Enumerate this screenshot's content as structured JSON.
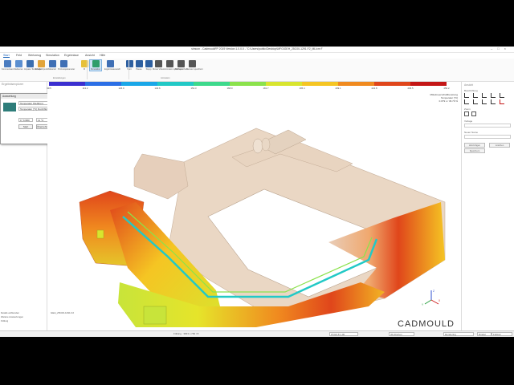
{
  "window": {
    "title": "simcon - CadmouldFP 2019 Version 1.0.0.0 - \"C:\\Users\\public\\Desktop\\MFG\\GEH_25C00-1291.F2_ML\\cm f\""
  },
  "menu": {
    "items": [
      "Start",
      "Feld",
      "Werkzeug",
      "Simulation",
      "Ergebnisse",
      "Ansicht",
      "Hilfe"
    ],
    "active_index": 0
  },
  "ribbon": {
    "buttons": [
      {
        "label": "Kommentare",
        "icon": "comment-icon",
        "color": "#4a7cc0"
      },
      {
        "label": "Markieren",
        "icon": "marker-icon",
        "color": "#5b8fd0"
      },
      {
        "label": "Anpass Textinhalte",
        "icon": "text-icon",
        "color": "#3b6fb0"
      },
      {
        "label": "Einspritzpunkt",
        "icon": "inject-icon",
        "color": "#e2a43a"
      },
      {
        "label": "Material",
        "icon": "material-icon",
        "color": "#3f6fb5"
      },
      {
        "label": "Prozessparameter",
        "icon": "process-icon",
        "color": "#3f6fb5"
      },
      {
        "label": "III",
        "icon": "lamp-icon",
        "color": "#e7c13a"
      },
      {
        "label": "Simulation",
        "icon": "simulation-icon",
        "color": "#2f9e6a"
      },
      {
        "label": "Ergebnisauswahl",
        "icon": "results-icon",
        "color": "#3f6fb5"
      },
      {
        "label": "Start",
        "icon": "play-icon",
        "color": "#2d5fa0"
      },
      {
        "label": "Pause",
        "icon": "pause-icon",
        "color": "#2d5fa0"
      },
      {
        "label": "Stopp",
        "icon": "stop-icon",
        "color": "#2d5fa0"
      },
      {
        "label": "Movie Video",
        "icon": "movie-icon",
        "color": "#555555"
      },
      {
        "label": "Animation speichern",
        "icon": "film-icon",
        "color": "#555555"
      },
      {
        "label": "Bild speichern",
        "icon": "camera-icon",
        "color": "#555555"
      },
      {
        "label": "Fenster speichern",
        "icon": "window-icon",
        "color": "#555555"
      }
    ],
    "groups": [
      "Einstellungen",
      "Animation"
    ]
  },
  "left_panel": {
    "header": "Ergebnisexplorer",
    "bottom_items": [
      "Details einblenden",
      "Weitere Auswertungen",
      "Füllung"
    ]
  },
  "dialog": {
    "title": "Auswertung",
    "field1": "Temperatur Fließfront Füllung",
    "field2": "Temperatur [°C] Durchfluß",
    "value_min": "0 °C/360",
    "value_max": "11 °C",
    "buttons": [
      "Start",
      "Wahl",
      "Anw",
      "Übernehmen"
    ]
  },
  "colorbar": {
    "ticks": [
      "99.5",
      "113.2",
      "126.9",
      "140.6",
      "154.3",
      "168.0",
      "181.7",
      "195.4",
      "209.1",
      "222.8",
      "236.5",
      "250.2"
    ],
    "colors": [
      "#3b2fd0",
      "#2b6fe6",
      "#1aa7e8",
      "#22c9c6",
      "#3dd98c",
      "#8be24c",
      "#d8e52e",
      "#f5c523",
      "#f08a1f",
      "#e0461b",
      "#c41616"
    ]
  },
  "result_info": {
    "line1": "Mittelmeerschaftbereitung",
    "line2": "Temperatur [°C]",
    "line3": "0.079 s / 36.79 %"
  },
  "geometry_label": "GEH_25C00-1291.F2",
  "logo": "CADMOULD",
  "axes": {
    "x": "X",
    "y": "Y",
    "z": "Z"
  },
  "right_panel": {
    "header": "Ansicht",
    "section1": "Beschriftung",
    "section2": "Zoom",
    "section3": "Vorlage",
    "section4": "Neuer Name",
    "btn_left": "Hinzufügen",
    "btn_right": "Löschen",
    "btn_extra": "Speichern"
  },
  "status": {
    "left": "",
    "zoom": "Füllung : 3843 s  782 / 8",
    "coords": "F5 E3.8 1.00",
    "mode": "3D-Drehen",
    "selector": "Rendering",
    "speed": "Rindal",
    "right": "Füllzeit"
  }
}
